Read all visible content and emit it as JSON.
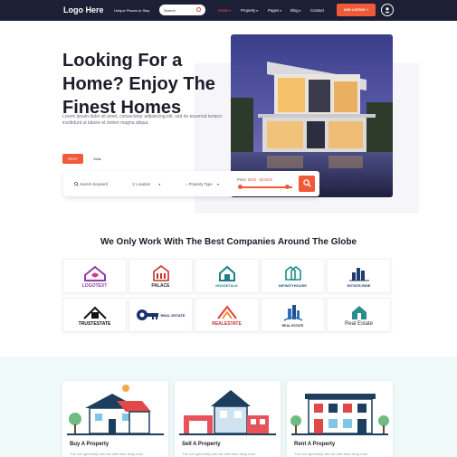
{
  "nav": {
    "logo": "Logo Here",
    "tagline": "Unique Places to Stay",
    "search_placeholder": "Search",
    "items": [
      {
        "label": "Home",
        "active": true,
        "caret": true
      },
      {
        "label": "Property",
        "active": false,
        "caret": true
      },
      {
        "label": "Pages",
        "active": false,
        "caret": true
      },
      {
        "label": "Blog",
        "active": false,
        "caret": true
      },
      {
        "label": "Contact",
        "active": false,
        "caret": false
      }
    ],
    "add_listing": "ADD LISTING +",
    "accent": "#f05a36",
    "bg": "#1c1f35"
  },
  "hero": {
    "title": "Looking For a Home? Enjoy The Finest Homes",
    "description": "Lorem ipsum dolor sit amet, consectetur adipisicing elit, sed do eiusmod tempor incididunt ut labore et dolore magna aliqua."
  },
  "search": {
    "tabs": [
      "RENT",
      "Sells"
    ],
    "keyword": "Search Keyword",
    "location": "Location",
    "property_type": "Property Type",
    "price_label": "Price:",
    "price_value": "$300 - $20000",
    "slider_low": 0.0,
    "slider_high": 0.9
  },
  "partners": {
    "title": "We Only Work With The Best Companies Around The Globe",
    "logos": [
      "LOGOTEXT",
      "PALACE",
      "HOUSETALK",
      "INFINITYHOUSE",
      "ESTATE-RISE",
      "TRUSTESTATE",
      "REAL ESTATE",
      "REALESTATE",
      "REAL ESTATE",
      "Real Estate"
    ]
  },
  "services": [
    {
      "title": "Buy A Property",
      "desc": "The non generally site we with auto drag rose."
    },
    {
      "title": "Sell A Property",
      "desc": "The non generally site we with auto drag rose."
    },
    {
      "title": "Rent A Property",
      "desc": "The non generally site we with auto drag rose."
    }
  ]
}
